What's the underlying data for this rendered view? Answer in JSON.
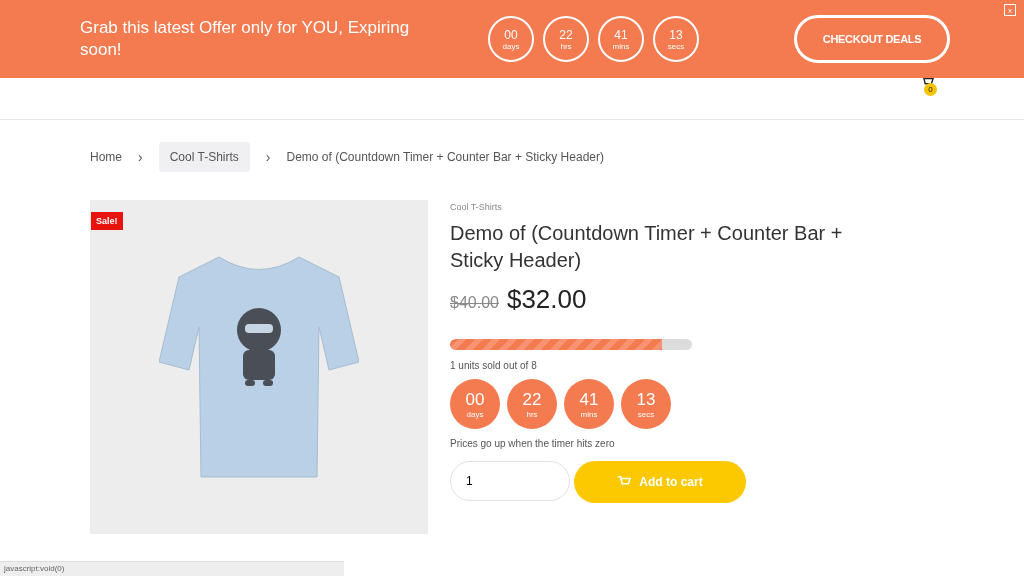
{
  "sticky_bar": {
    "message": "Grab this latest Offer only for YOU, Expiring soon!",
    "timer": [
      {
        "value": "00",
        "unit": "days"
      },
      {
        "value": "22",
        "unit": "hrs"
      },
      {
        "value": "41",
        "unit": "mins"
      },
      {
        "value": "13",
        "unit": "secs"
      }
    ],
    "button": "CHECKOUT DEALS",
    "close": "x"
  },
  "header": {
    "cart_count": "0"
  },
  "breadcrumb": [
    {
      "label": "Home",
      "kind": "link"
    },
    {
      "label": "›",
      "kind": "separator"
    },
    {
      "label": "Cool T-Shirts",
      "kind": "pill"
    },
    {
      "label": "›",
      "kind": "separator"
    },
    {
      "label": "Demo of (Countdown Timer + Counter Bar + Sticky Header)",
      "kind": "current"
    }
  ],
  "product": {
    "badge": "Sale!",
    "category": "Cool T-Shirts",
    "title": "Demo of (Countdown Timer + Counter Bar + Sticky Header)",
    "old_price": "$40.00",
    "price": "$32.00",
    "counter_bar": {
      "level": 0.875,
      "caption": "1 units sold out of 8"
    },
    "timer": [
      {
        "value": "00",
        "unit": "days"
      },
      {
        "value": "22",
        "unit": "hrs"
      },
      {
        "value": "41",
        "unit": "mins"
      },
      {
        "value": "13",
        "unit": "secs"
      }
    ],
    "timer_note": "Prices go up when the timer hits zero",
    "quantity": "1",
    "add_button": "Add to cart"
  },
  "status_bar": {
    "url": "javascript:void(0)"
  }
}
